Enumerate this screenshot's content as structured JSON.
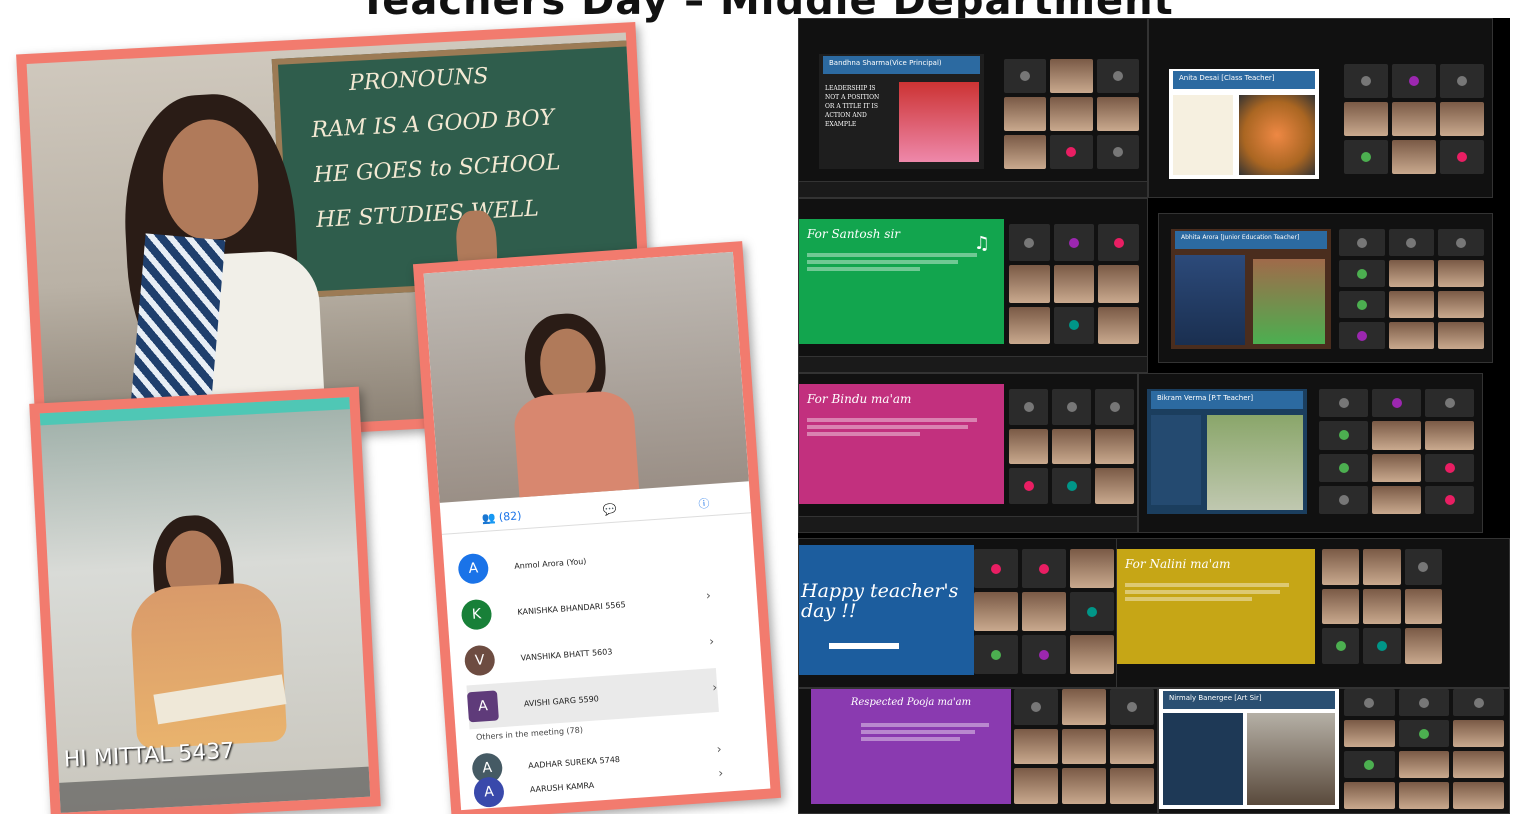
{
  "page": {
    "title": "Teachers Day – Middle Department"
  },
  "colors": {
    "frame": "#f27b6e",
    "background": "#ffffff",
    "collage_bg": "#000000"
  },
  "photo_reading": {
    "name_tag": "HI MITTAL 5437"
  },
  "meet_app": {
    "tab_people": "(82)",
    "participants": [
      {
        "initial": "A",
        "name": "Anmol Arora (You)",
        "color": "#1a73e8"
      },
      {
        "initial": "K",
        "name": "KANISHKA BHANDARI 5565",
        "color": "#188038"
      },
      {
        "initial": "V",
        "name": "VANSHIKA BHATT 5603",
        "color": "#6d4c41"
      },
      {
        "initial": "A",
        "name": "AVISHI GARG 5590",
        "color": "#5f3b7a"
      }
    ],
    "others_label": "Others in the meeting (78)",
    "others": [
      {
        "initial": "A",
        "name": "AADHAR SUREKA 5748",
        "color": "#455a64"
      },
      {
        "initial": "A",
        "name": "AARUSH KAMRA",
        "color": "#3949ab"
      }
    ]
  },
  "slides": {
    "s1_banner": "Bandhna Sharma(Vice Principal)",
    "s1_quote": "LEADERSHIP IS NOT A POSITION OR A TITLE IT IS ACTION AND EXAMPLE",
    "s2_banner": "Anita Desai [Class Teacher]",
    "s3_title": "For Santosh sir",
    "s4_banner": "Abhita Arora [Junior Education Teacher]",
    "s5_title": "For Bindu ma'am",
    "s6_banner": "Bikram Verma [P.T Teacher]",
    "s7_title": "Happy teacher's day !!",
    "s8_title": "For Nalini ma'am",
    "s9_title": "Respected Pooja ma'am",
    "s10_banner": "Nirmaly Banergee [Art Sir]"
  }
}
